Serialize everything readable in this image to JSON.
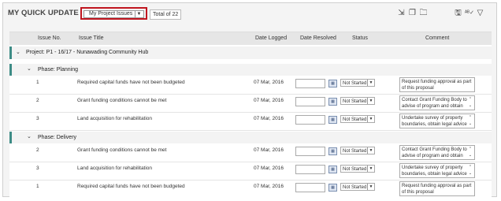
{
  "header": {
    "title": "MY QUICK UPDATE",
    "filter_select": "My Project Issues",
    "total": "Total of 22"
  },
  "toolbar_icons": [
    "export-icon",
    "copy-icon",
    "folder-icon",
    "save-icon",
    "spellcheck-icon",
    "filter-icon"
  ],
  "columns": [
    "Issue No.",
    "Issue Title",
    "Date Logged",
    "Date Resolved",
    "Status",
    "Comment"
  ],
  "project": {
    "label": "Project: P1 - 16/17 - Nunawading Community Hub"
  },
  "phases": [
    {
      "label": "Phase: Planning",
      "rows": [
        {
          "no": "1",
          "title": "Required capital funds have not been budgeted",
          "date": "07 Mar, 2016",
          "status": "Not Started",
          "comment": "Request funding approval as part of this proposal"
        },
        {
          "no": "2",
          "title": "Grant funding conditions cannot be met",
          "date": "07 Mar, 2016",
          "status": "Not Started",
          "comment": "Contact Grant Funding Body to advise of program and obtain"
        },
        {
          "no": "3",
          "title": "Land acquisition for rehabilitation",
          "date": "07 Mar, 2016",
          "status": "Not Started",
          "comment": "Undertake survey of property boundaries, obtain legal advice"
        }
      ]
    },
    {
      "label": "Phase: Delivery",
      "rows": [
        {
          "no": "2",
          "title": "Grant funding conditions cannot be met",
          "date": "07 Mar, 2016",
          "status": "Not Started",
          "comment": "Contact Grant Funding Body to advise of program and obtain"
        },
        {
          "no": "3",
          "title": "Land acquisition for rehabilitation",
          "date": "07 Mar, 2016",
          "status": "Not Started",
          "comment": "Undertake survey of property boundaries, obtain legal advice"
        },
        {
          "no": "1",
          "title": "Required capital funds have not been budgeted",
          "date": "07 Mar, 2016",
          "status": "Not Started",
          "comment": "Request funding approval as part of this proposal"
        }
      ]
    }
  ],
  "colors": {
    "accent": "#3d8c86",
    "highlight": "#c0161f",
    "header_bg": "#e6e6e6"
  }
}
